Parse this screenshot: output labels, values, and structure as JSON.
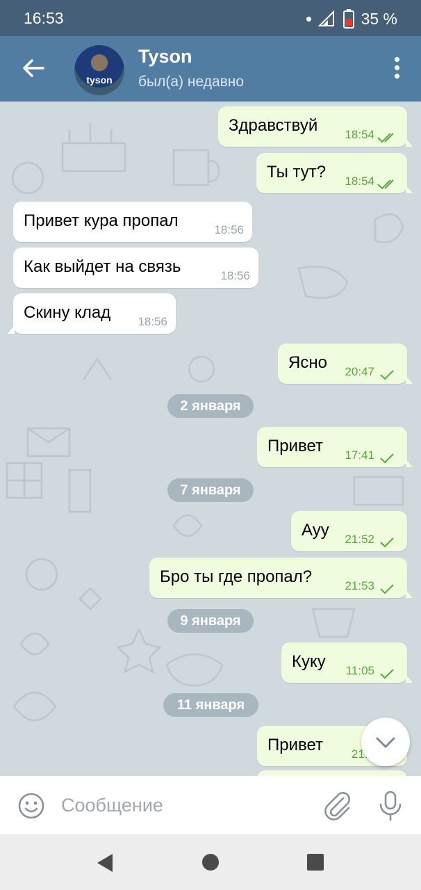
{
  "status_bar": {
    "time": "16:53",
    "battery": "35 %"
  },
  "header": {
    "title": "Tyson",
    "subtitle": "был(а) недавно",
    "avatar_text": "tyson"
  },
  "messages": [
    {
      "text": "Здравствуй",
      "time": "18:54"
    },
    {
      "text": "Ты тут?",
      "time": "18:54"
    },
    {
      "text": "Привет кура пропал",
      "time": "18:56"
    },
    {
      "text": "Как выйдет на связь",
      "time": "18:56"
    },
    {
      "text": "Скину клад",
      "time": "18:56"
    },
    {
      "text": "Ясно",
      "time": "20:47"
    },
    {
      "text": "Привет",
      "time": "17:41"
    },
    {
      "text": "Ауу",
      "time": "21:52"
    },
    {
      "text": "Бро ты где пропал?",
      "time": "21:53"
    },
    {
      "text": "Куку",
      "time": "11:05"
    },
    {
      "text": "Привет",
      "time": "21:4"
    }
  ],
  "dates": [
    "2 января",
    "7 января",
    "9 января",
    "11 января"
  ],
  "input": {
    "placeholder": "Сообщение"
  },
  "colors": {
    "header": "#527da3",
    "status_bar": "#445f77",
    "outgoing_bubble": "#effdde",
    "check": "#58a73e"
  }
}
